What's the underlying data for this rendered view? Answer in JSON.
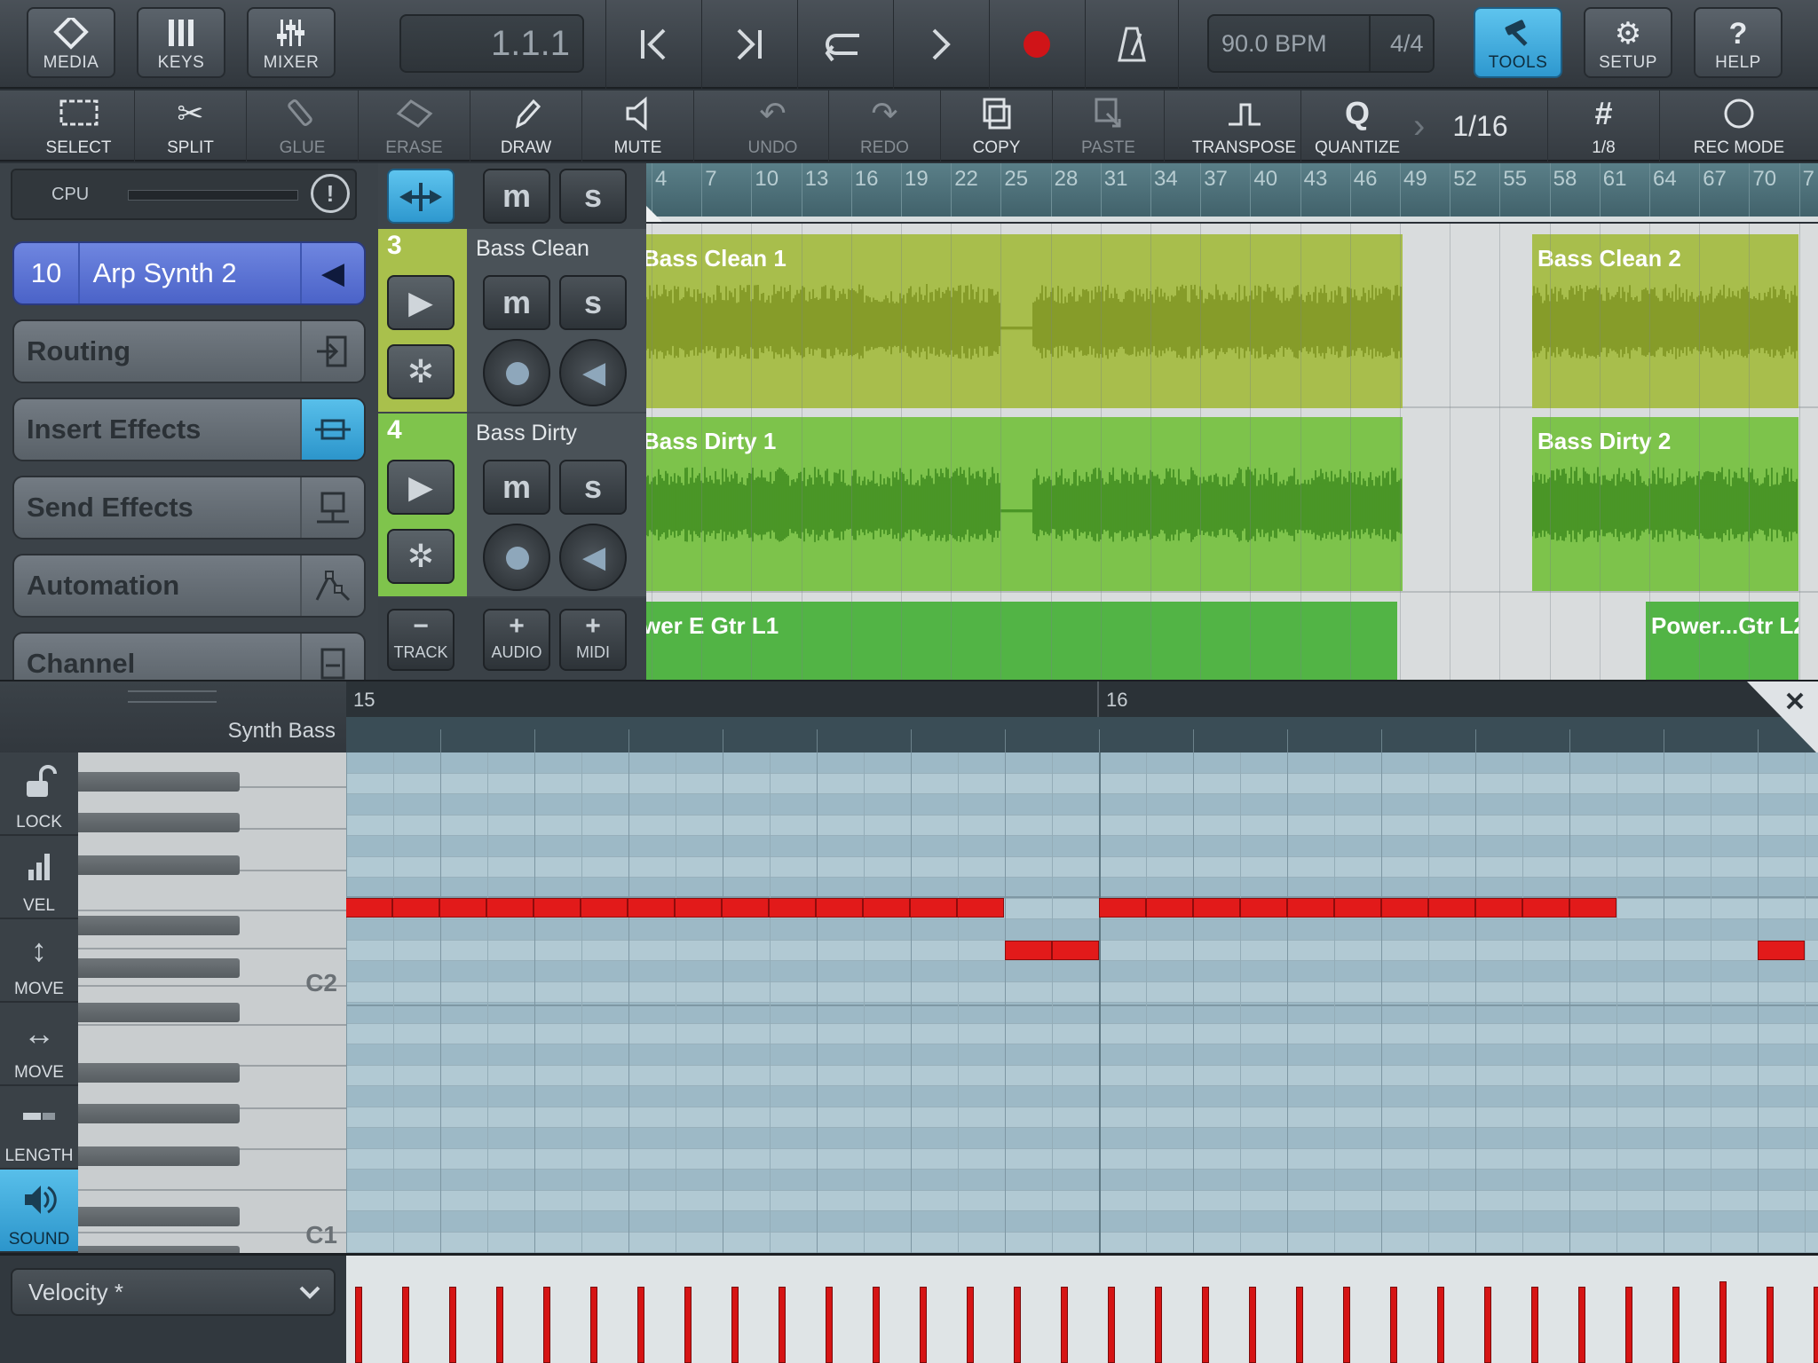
{
  "topbar": {
    "media_label": "MEDIA",
    "keys_label": "KEYS",
    "mixer_label": "MIXER",
    "position": "1.1.1",
    "tempo": "90.0 BPM",
    "signature": "4/4",
    "tools_label": "TOOLS",
    "setup_label": "SETUP",
    "help_label": "HELP"
  },
  "toolbar": {
    "select": "SELECT",
    "split": "SPLIT",
    "glue": "GLUE",
    "erase": "ERASE",
    "draw": "DRAW",
    "mute": "MUTE",
    "undo": "UNDO",
    "redo": "REDO",
    "copy": "COPY",
    "paste": "PASTE",
    "transpose": "TRANSPOSE",
    "quantize": "QUANTIZE",
    "quantize_value": "1/16",
    "grid_value": "1/8",
    "rec_mode": "REC MODE"
  },
  "inspector": {
    "cpu_label": "CPU",
    "cpu_level": 0.0,
    "track_number": "10",
    "track_name": "Arp Synth 2",
    "routing": "Routing",
    "insert_effects": "Insert Effects",
    "send_effects": "Send Effects",
    "automation": "Automation",
    "channel": "Channel"
  },
  "tracks": [
    {
      "number": "3",
      "name": "Bass Clean",
      "color": "#a8c04a"
    },
    {
      "number": "4",
      "name": "Bass Dirty",
      "color": "#7dc34b"
    }
  ],
  "track_buttons": {
    "track": "TRACK",
    "audio": "AUDIO",
    "midi": "MIDI"
  },
  "ruler_ticks": [
    "4",
    "7",
    "10",
    "13",
    "16",
    "19",
    "22",
    "25",
    "28",
    "31",
    "34",
    "37",
    "40",
    "43",
    "46",
    "49",
    "52",
    "55",
    "58",
    "61",
    "64",
    "67",
    "70",
    "7"
  ],
  "clips": {
    "bass_clean_1": "Bass Clean 1",
    "bass_clean_2": "Bass Clean 2",
    "bass_dirty_1": "Bass Dirty 1",
    "bass_dirty_2": "Bass Dirty 2",
    "gtr_1": "wer E Gtr L1",
    "gtr_2": "Power...Gtr L2"
  },
  "pianoroll": {
    "instrument": "Synth Bass",
    "bar_15": "15",
    "bar_16": "16",
    "key_c2": "C2",
    "key_c1": "C1",
    "lock": "LOCK",
    "vel": "VEL",
    "move_v": "MOVE",
    "move_h": "MOVE",
    "length": "LENGTH",
    "sound": "SOUND",
    "velocity_select": "Velocity *"
  }
}
